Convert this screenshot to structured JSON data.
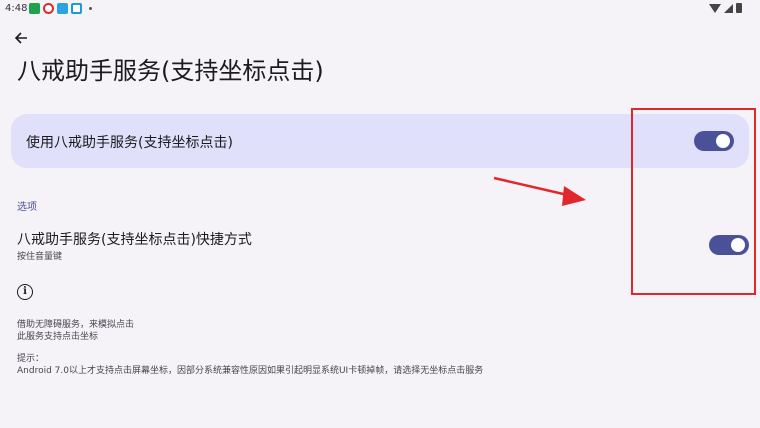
{
  "status_bar": {
    "time": "4:48",
    "notification_icons": [
      "app-green-icon",
      "app-red-icon",
      "app-blue-icon",
      "app-teal-icon"
    ],
    "system_icons": [
      "wifi-icon",
      "signal-icon",
      "battery-icon"
    ]
  },
  "header": {
    "back_icon": "arrow-left-icon",
    "title": "八戒助手服务(支持坐标点击)"
  },
  "main_switch": {
    "label": "使用八戒助手服务(支持坐标点击)",
    "checked": true
  },
  "options_section": {
    "header": "选项",
    "shortcut_title": "八戒助手服务(支持坐标点击)快捷方式",
    "shortcut_summary": "按住音量键",
    "shortcut_checked": true
  },
  "info": {
    "icon": "info-icon",
    "description_lines": [
      "借助无障碍服务，来模拟点击",
      "此服务支持点击坐标"
    ],
    "tips_label": "提示：",
    "tips_text": "Android 7.0以上才支持点击屏幕坐标，因部分系统兼容性原因如果引起明显系统UI卡顿掉帧，请选择无坐标点击服务"
  },
  "annotations": {
    "highlight_color": "#e0282c"
  },
  "colors": {
    "accent": "#4a5199",
    "card_background": "#e1e0fb",
    "page_background": "#f5f2f8"
  }
}
